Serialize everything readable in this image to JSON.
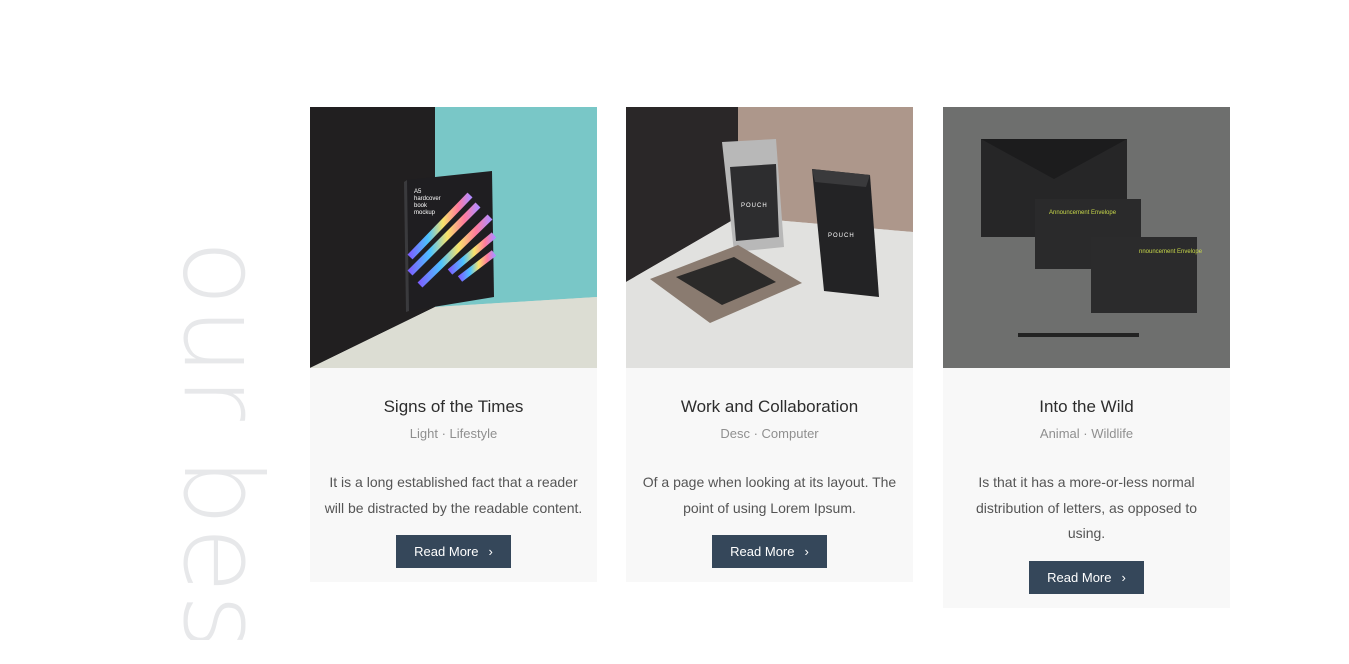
{
  "section": {
    "side_title": "our best"
  },
  "cards": [
    {
      "title": "Signs of the Times",
      "meta": "Light · Lifestyle",
      "desc": "It is a long established fact that a reader will be distracted by the readable content.",
      "button_label": "Read More",
      "image_text": [
        "A5",
        "hardcover",
        "book",
        "mockup"
      ]
    },
    {
      "title": "Work and Collaboration",
      "meta": "Desc · Computer",
      "desc": "Of a page when looking at its layout. The point of using Lorem Ipsum.",
      "button_label": "Read More",
      "image_text": [
        "POUCH"
      ]
    },
    {
      "title": "Into the Wild",
      "meta": "Animal · Wildlife",
      "desc": "Is that it has a more-or-less normal distribution of letters, as opposed to using.",
      "button_label": "Read More",
      "image_text": [
        "Announcement Envelope",
        "nnouncement Envelope"
      ]
    }
  ],
  "icons": {
    "button_icon": "chevron-right-icon"
  },
  "colors": {
    "button_bg": "#35475a",
    "card_bg": "#f8f8f8",
    "side_title": "#e7e8ea"
  }
}
